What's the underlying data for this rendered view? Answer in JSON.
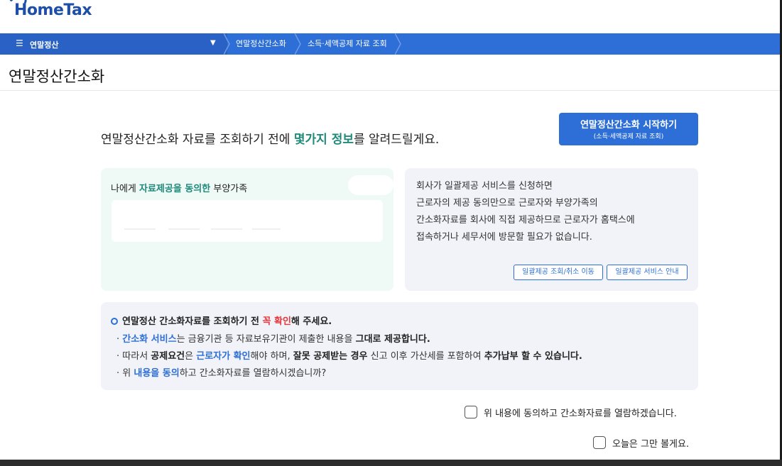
{
  "header": {
    "logo_text": "HomeTax"
  },
  "navbar": {
    "menu_label": "연말정산",
    "breadcrumbs": [
      "연말정산간소화",
      "소득·세액공제 자료 조회"
    ]
  },
  "page": {
    "title": "연말정산간소화"
  },
  "intro": {
    "text_before": "연말정산간소화 자료를 조회하기 전에 ",
    "highlight": "몇가지 정보",
    "text_after": "를 알려드릴게요."
  },
  "start_button": {
    "label": "연말정산간소화 시작하기",
    "sublabel": "(소득·세액공제 자료 조회)"
  },
  "consent_card": {
    "prefix": "나에게 ",
    "highlight": "자료제공을 동의한",
    "suffix": " 부양가족"
  },
  "info_card": {
    "lines": [
      "회사가 일괄제공 서비스를 신청하면",
      "근로자의 제공 동의만으로 근로자와 부양가족의",
      "간소화자료를 회사에 직접 제공하므로 근로자가 홈택스에",
      "접속하거나 세무서에 방문할 필요가 없습니다."
    ],
    "buttons": [
      "일괄제공 조회/취소 이동",
      "일괄제공 서비스 안내"
    ]
  },
  "notice": {
    "heading_before": "연말정산 간소화자료를 조회하기 전 ",
    "heading_red": "꼭 확인",
    "heading_after": "해 주세요.",
    "line1": {
      "blue": "간소화 서비스",
      "mid": "는 금융기관 등 자료보유기관이 제출한 내용을 ",
      "bold": "그대로 제공합니다."
    },
    "line2": {
      "a": "따라서 ",
      "b_bold": "공제요건",
      "c": "은 ",
      "d_blue": "근로자가 확인",
      "e": "해야 하며, ",
      "f_bold": "잘못 공제받는 경우",
      "g": " 신고 이후 가산세를 포함하여 ",
      "h_bold": "추가납부 할 수 있습니다."
    },
    "line3": {
      "a": "위 ",
      "b_blue": "내용을 동의",
      "c": "하고 간소화자료를 열람하시겠습니까?"
    }
  },
  "checkboxes": {
    "agree_label": "위 내용에 동의하고 간소화자료를 열람하겠습니다.",
    "hide_today_label": "오늘은 그만 볼게요."
  }
}
